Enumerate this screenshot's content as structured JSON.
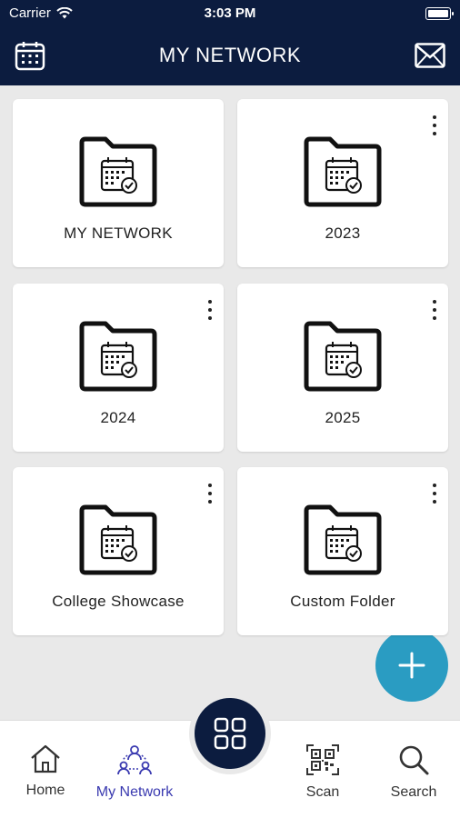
{
  "status_bar": {
    "carrier": "Carrier",
    "time": "3:03 PM"
  },
  "header": {
    "title": "MY NETWORK",
    "left_icon": "calendar-icon",
    "right_icon": "mail-icon"
  },
  "folders": [
    {
      "label": "MY NETWORK",
      "has_menu": false
    },
    {
      "label": "2023",
      "has_menu": true
    },
    {
      "label": "2024",
      "has_menu": true
    },
    {
      "label": "2025",
      "has_menu": true
    },
    {
      "label": "College Showcase",
      "has_menu": true
    },
    {
      "label": "Custom Folder",
      "has_menu": true
    }
  ],
  "fab": {
    "icon": "plus-icon"
  },
  "bottom_nav": {
    "items": [
      {
        "label": "Home",
        "icon": "home-icon",
        "active": false
      },
      {
        "label": "My Network",
        "icon": "network-icon",
        "active": true
      },
      {
        "label": "Scan",
        "icon": "qr-code-icon",
        "active": false
      },
      {
        "label": "Search",
        "icon": "search-icon",
        "active": false
      }
    ],
    "center_icon": "grid-icon"
  },
  "colors": {
    "header_bg": "#0c1c3f",
    "accent": "#2a9cc2",
    "active_tab": "#3a3ab0",
    "background": "#e9e9e9"
  }
}
